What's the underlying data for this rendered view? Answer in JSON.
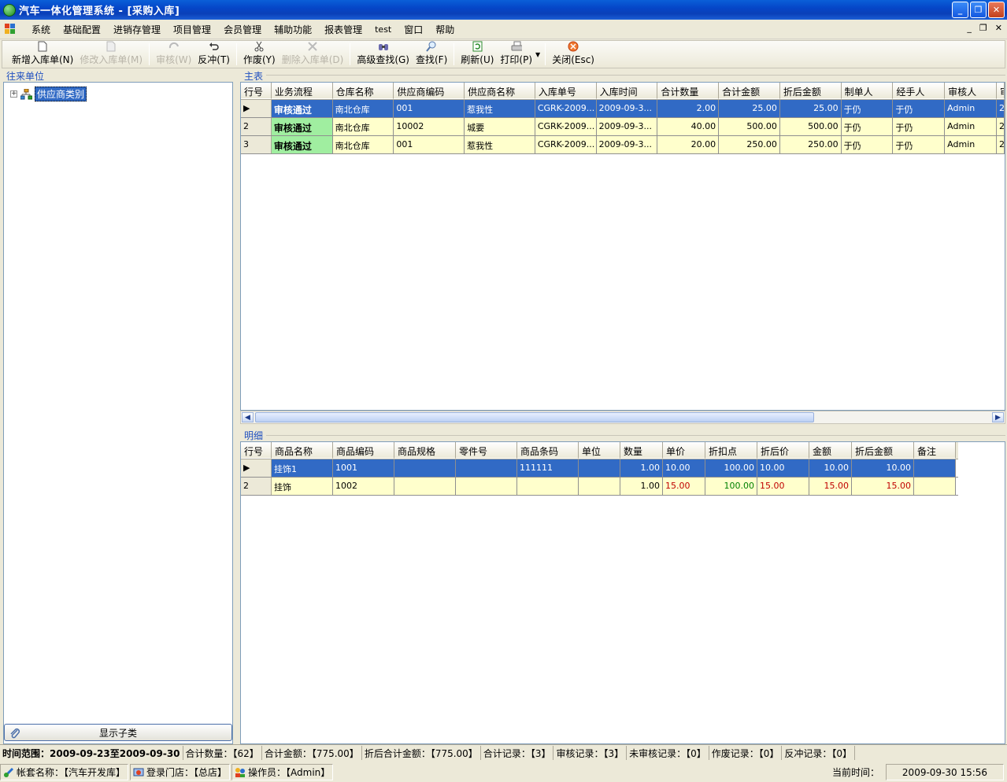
{
  "window": {
    "title": "汽车一体化管理系统 - [采购入库]",
    "controls": {
      "minimize": "_",
      "restore": "❐",
      "close": "✕"
    }
  },
  "menu": {
    "items": [
      "系统",
      "基础配置",
      "进销存管理",
      "项目管理",
      "会员管理",
      "辅助功能",
      "报表管理",
      "test",
      "窗口",
      "帮助"
    ],
    "mdi_controls": {
      "minimize": "_",
      "restore": "❐",
      "close": "✕"
    }
  },
  "toolbar": {
    "buttons": [
      {
        "label": "新增入库单(N)",
        "icon": "new-document-icon",
        "enabled": true
      },
      {
        "label": "修改入库单(M)",
        "icon": "edit-document-icon",
        "enabled": false
      },
      {
        "label": "审核(W)",
        "icon": "audit-icon",
        "enabled": false
      },
      {
        "label": "反冲(T)",
        "icon": "undo-icon",
        "enabled": true
      },
      {
        "label": "作废(Y)",
        "icon": "scissors-icon",
        "enabled": true
      },
      {
        "label": "删除入库单(D)",
        "icon": "delete-icon",
        "enabled": false
      },
      {
        "label": "高级查找(G)",
        "icon": "binoculars-icon",
        "enabled": true
      },
      {
        "label": "查找(F)",
        "icon": "search-icon",
        "enabled": true
      },
      {
        "label": "刷新(U)",
        "icon": "refresh-icon",
        "enabled": true
      },
      {
        "label": "打印(P)",
        "icon": "printer-icon",
        "enabled": true
      },
      {
        "label": "关闭(Esc)",
        "icon": "close-circle-icon",
        "enabled": true
      }
    ]
  },
  "left_panel": {
    "label": "往来单位",
    "tree_root": "供应商类别",
    "show_sub_button": "显示子类"
  },
  "main_table": {
    "label": "主表",
    "columns": [
      "行号",
      "业务流程",
      "仓库名称",
      "供应商编码",
      "供应商名称",
      "入库单号",
      "入库时间",
      "合计数量",
      "合计金额",
      "折后金额",
      "制单人",
      "经手人",
      "审核人",
      "审"
    ],
    "rows": [
      {
        "rownum": "",
        "status": "审核通过",
        "warehouse": "南北仓库",
        "supplier_code": "001",
        "supplier_name": "惹我性",
        "order_no": "CGRK-2009...",
        "time": "2009-09-3...",
        "qty": "2.00",
        "amount": "25.00",
        "discount_amount": "25.00",
        "creator": "于仍",
        "handler": "于仍",
        "auditor": "Admin",
        "extra": "2",
        "selected": true
      },
      {
        "rownum": "2",
        "status": "审核通过",
        "warehouse": "南北仓库",
        "supplier_code": "10002",
        "supplier_name": "城要",
        "order_no": "CGRK-2009...",
        "time": "2009-09-3...",
        "qty": "40.00",
        "amount": "500.00",
        "discount_amount": "500.00",
        "creator": "于仍",
        "handler": "于仍",
        "auditor": "Admin",
        "extra": "2",
        "selected": false
      },
      {
        "rownum": "3",
        "status": "审核通过",
        "warehouse": "南北仓库",
        "supplier_code": "001",
        "supplier_name": "惹我性",
        "order_no": "CGRK-2009...",
        "time": "2009-09-3...",
        "qty": "20.00",
        "amount": "250.00",
        "discount_amount": "250.00",
        "creator": "于仍",
        "handler": "于仍",
        "auditor": "Admin",
        "extra": "2",
        "selected": false
      }
    ]
  },
  "detail_table": {
    "label": "明细",
    "columns": [
      "行号",
      "商品名称",
      "商品编码",
      "商品规格",
      "零件号",
      "商品条码",
      "单位",
      "数量",
      "单价",
      "折扣点",
      "折后价",
      "金额",
      "折后金额",
      "备注"
    ],
    "rows": [
      {
        "rownum": "",
        "name": "挂饰1",
        "code": "1001",
        "spec": "",
        "part_no": "",
        "barcode": "111111",
        "unit": "",
        "qty": "1.00",
        "price": "10.00",
        "discount": "100.00",
        "disc_price": "10.00",
        "amount": "10.00",
        "disc_amount": "10.00",
        "note": "",
        "selected": true
      },
      {
        "rownum": "2",
        "name": "挂饰",
        "code": "1002",
        "spec": "",
        "part_no": "",
        "barcode": "",
        "unit": "",
        "qty": "1.00",
        "price": "15.00",
        "discount": "100.00",
        "disc_price": "15.00",
        "amount": "15.00",
        "disc_amount": "15.00",
        "note": "",
        "selected": false
      }
    ]
  },
  "status_bar": {
    "time_range": "时间范围：2009-09-23至2009-09-30",
    "total_qty": "合计数量：【62】",
    "total_amount": "合计金额：【775.00】",
    "discount_total": "折后合计金额：【775.00】",
    "total_records": "合计记录：【3】",
    "audited_records": "审核记录：【3】",
    "unaudited_records": "未审核记录：【0】",
    "void_records": "作废记录：【0】",
    "reversal_records": "反冲记录：【0】"
  },
  "bottom_bar": {
    "account": "帐套名称：【汽车开发库】",
    "store": "登录门店：【总店】",
    "operator": "操作员：【Admin】",
    "current_time_label": "当前时间：",
    "current_time": "2009-09-30 15:56"
  },
  "colors": {
    "title_bar": "#0546c8",
    "selection": "#316ac5",
    "row_bg": "#ffffcc",
    "status_green": "#a0eea0",
    "price_red": "#c00000",
    "discount_green": "#008000"
  }
}
